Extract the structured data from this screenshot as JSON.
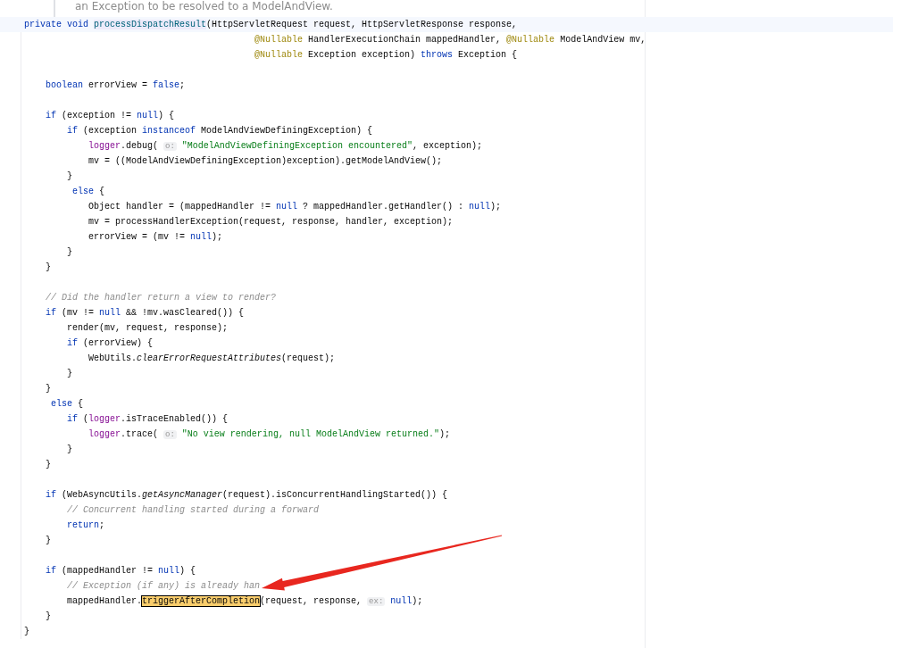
{
  "doc_comment": "an Exception to be resolved to a ModelAndView.",
  "lines": [
    {
      "kind": "code",
      "current": true,
      "tokens": [
        {
          "kind": "kw",
          "t": "private void "
        },
        {
          "kind": "decl",
          "t": "processDispatchResult"
        },
        {
          "kind": "p",
          "t": "(HttpServletRequest request, HttpServletResponse response,"
        }
      ]
    },
    {
      "kind": "code",
      "current": false,
      "tokens": [
        {
          "kind": "ann",
          "t": "                                           @Nullable"
        },
        {
          "kind": "p",
          "t": " HandlerExecutionChain mappedHandler, "
        },
        {
          "kind": "ann",
          "t": "@Nullable"
        },
        {
          "kind": "p",
          "t": " ModelAndView mv,"
        }
      ]
    },
    {
      "kind": "code",
      "current": false,
      "tokens": [
        {
          "kind": "ann",
          "t": "                                           @Nullable"
        },
        {
          "kind": "p",
          "t": " Exception exception) "
        },
        {
          "kind": "kw",
          "t": "throws"
        },
        {
          "kind": "p",
          "t": " Exception {"
        }
      ]
    },
    {
      "kind": "blank",
      "current": false
    },
    {
      "kind": "code",
      "current": false,
      "tokens": [
        {
          "kind": "kw",
          "t": "    boolean"
        },
        {
          "kind": "p",
          "t": " errorView = "
        },
        {
          "kind": "kw",
          "t": "false"
        },
        {
          "kind": "p",
          "t": ";"
        }
      ]
    },
    {
      "kind": "blank",
      "current": false
    },
    {
      "kind": "code",
      "current": false,
      "tokens": [
        {
          "kind": "kw",
          "t": "    if"
        },
        {
          "kind": "p",
          "t": " (exception != "
        },
        {
          "kind": "kw",
          "t": "null"
        },
        {
          "kind": "p",
          "t": ") {"
        }
      ]
    },
    {
      "kind": "code",
      "current": false,
      "tokens": [
        {
          "kind": "kw",
          "t": "        if"
        },
        {
          "kind": "p",
          "t": " (exception "
        },
        {
          "kind": "kw",
          "t": "instanceof"
        },
        {
          "kind": "p",
          "t": " ModelAndViewDefiningException) {"
        }
      ]
    },
    {
      "kind": "code",
      "current": false,
      "tokens": [
        {
          "kind": "fld",
          "t": "            logger"
        },
        {
          "kind": "p",
          "t": ".debug( "
        },
        {
          "kind": "hint",
          "t": "o:"
        },
        {
          "kind": "str",
          "t": " \"ModelAndViewDefiningException encountered\""
        },
        {
          "kind": "p",
          "t": ", exception);"
        }
      ]
    },
    {
      "kind": "code",
      "current": false,
      "tokens": [
        {
          "kind": "p",
          "t": "            mv = ((ModelAndViewDefiningException)exception).getModelAndView();"
        }
      ]
    },
    {
      "kind": "code",
      "current": false,
      "tokens": [
        {
          "kind": "p",
          "t": "        }"
        }
      ]
    },
    {
      "kind": "code",
      "current": false,
      "tokens": [
        {
          "kind": "kw",
          "t": "         else"
        },
        {
          "kind": "p",
          "t": " {"
        }
      ]
    },
    {
      "kind": "code",
      "current": false,
      "tokens": [
        {
          "kind": "p",
          "t": "            Object handler = (mappedHandler != "
        },
        {
          "kind": "kw",
          "t": "null"
        },
        {
          "kind": "p",
          "t": " ? mappedHandler.getHandler() : "
        },
        {
          "kind": "kw",
          "t": "null"
        },
        {
          "kind": "p",
          "t": ");"
        }
      ]
    },
    {
      "kind": "code",
      "current": false,
      "tokens": [
        {
          "kind": "p",
          "t": "            mv = processHandlerException(request, response, handler, exception);"
        }
      ]
    },
    {
      "kind": "code",
      "current": false,
      "tokens": [
        {
          "kind": "p",
          "t": "            errorView = (mv != "
        },
        {
          "kind": "kw",
          "t": "null"
        },
        {
          "kind": "p",
          "t": ");"
        }
      ]
    },
    {
      "kind": "code",
      "current": false,
      "tokens": [
        {
          "kind": "p",
          "t": "        }"
        }
      ]
    },
    {
      "kind": "code",
      "current": false,
      "tokens": [
        {
          "kind": "p",
          "t": "    }"
        }
      ]
    },
    {
      "kind": "blank",
      "current": false
    },
    {
      "kind": "code",
      "current": false,
      "tokens": [
        {
          "kind": "cmt",
          "t": "    // Did the handler return a view to render?"
        }
      ]
    },
    {
      "kind": "code",
      "current": false,
      "tokens": [
        {
          "kind": "kw",
          "t": "    if"
        },
        {
          "kind": "p",
          "t": " (mv != "
        },
        {
          "kind": "kw",
          "t": "null"
        },
        {
          "kind": "p",
          "t": " && !mv.wasCleared()) {"
        }
      ]
    },
    {
      "kind": "code",
      "current": false,
      "tokens": [
        {
          "kind": "p",
          "t": "        render(mv, request, response);"
        }
      ]
    },
    {
      "kind": "code",
      "current": false,
      "tokens": [
        {
          "kind": "kw",
          "t": "        if"
        },
        {
          "kind": "p",
          "t": " (errorView) {"
        }
      ]
    },
    {
      "kind": "code",
      "current": false,
      "tokens": [
        {
          "kind": "p",
          "t": "            WebUtils."
        },
        {
          "kind": "ital",
          "t": "clearErrorRequestAttributes"
        },
        {
          "kind": "p",
          "t": "(request);"
        }
      ]
    },
    {
      "kind": "code",
      "current": false,
      "tokens": [
        {
          "kind": "p",
          "t": "        }"
        }
      ]
    },
    {
      "kind": "code",
      "current": false,
      "tokens": [
        {
          "kind": "p",
          "t": "    }"
        }
      ]
    },
    {
      "kind": "code",
      "current": false,
      "tokens": [
        {
          "kind": "kw",
          "t": "     else"
        },
        {
          "kind": "p",
          "t": " {"
        }
      ]
    },
    {
      "kind": "code",
      "current": false,
      "tokens": [
        {
          "kind": "kw",
          "t": "        if"
        },
        {
          "kind": "p",
          "t": " ("
        },
        {
          "kind": "fld",
          "t": "logger"
        },
        {
          "kind": "p",
          "t": ".isTraceEnabled()) {"
        }
      ]
    },
    {
      "kind": "code",
      "current": false,
      "tokens": [
        {
          "kind": "fld",
          "t": "            logger"
        },
        {
          "kind": "p",
          "t": ".trace( "
        },
        {
          "kind": "hint",
          "t": "o:"
        },
        {
          "kind": "str",
          "t": " \"No view rendering, null ModelAndView returned.\""
        },
        {
          "kind": "p",
          "t": ");"
        }
      ]
    },
    {
      "kind": "code",
      "current": false,
      "tokens": [
        {
          "kind": "p",
          "t": "        }"
        }
      ]
    },
    {
      "kind": "code",
      "current": false,
      "tokens": [
        {
          "kind": "p",
          "t": "    }"
        }
      ]
    },
    {
      "kind": "blank",
      "current": false
    },
    {
      "kind": "code",
      "current": false,
      "tokens": [
        {
          "kind": "kw",
          "t": "    if"
        },
        {
          "kind": "p",
          "t": " (WebAsyncUtils."
        },
        {
          "kind": "ital",
          "t": "getAsyncManager"
        },
        {
          "kind": "p",
          "t": "(request).isConcurrentHandlingStarted()) {"
        }
      ]
    },
    {
      "kind": "code",
      "current": false,
      "tokens": [
        {
          "kind": "cmt",
          "t": "        // Concurrent handling started during a forward"
        }
      ]
    },
    {
      "kind": "code",
      "current": false,
      "tokens": [
        {
          "kind": "kw",
          "t": "        return"
        },
        {
          "kind": "p",
          "t": ";"
        }
      ]
    },
    {
      "kind": "code",
      "current": false,
      "tokens": [
        {
          "kind": "p",
          "t": "    }"
        }
      ]
    },
    {
      "kind": "blank",
      "current": false
    },
    {
      "kind": "code",
      "current": false,
      "tokens": [
        {
          "kind": "kw",
          "t": "    if"
        },
        {
          "kind": "p",
          "t": " (mappedHandler != "
        },
        {
          "kind": "kw",
          "t": "null"
        },
        {
          "kind": "p",
          "t": ") {"
        }
      ]
    },
    {
      "kind": "code",
      "current": false,
      "tokens": [
        {
          "kind": "cmt",
          "t": "        // Exception (if any) is already han"
        }
      ]
    },
    {
      "kind": "code",
      "current": false,
      "tokens": [
        {
          "kind": "p",
          "t": "        mappedHandler."
        },
        {
          "kind": "hl",
          "t": "triggerAfterCompletion"
        },
        {
          "kind": "p",
          "t": "(request, response, "
        },
        {
          "kind": "hint",
          "t": "ex:"
        },
        {
          "kind": "kw",
          "t": " null"
        },
        {
          "kind": "p",
          "t": ");"
        }
      ]
    },
    {
      "kind": "code",
      "current": false,
      "tokens": [
        {
          "kind": "p",
          "t": "    }"
        }
      ]
    },
    {
      "kind": "code",
      "current": false,
      "tokens": [
        {
          "kind": "p",
          "t": "}"
        }
      ]
    }
  ]
}
